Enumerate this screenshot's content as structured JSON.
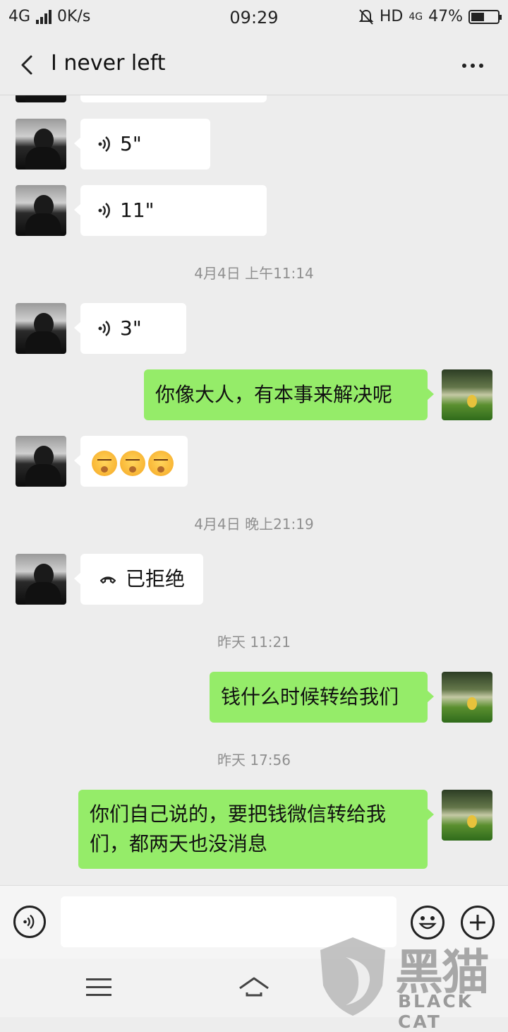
{
  "status_bar": {
    "network": "4G",
    "speed": "0K/s",
    "time": "09:29",
    "hd": "HD",
    "network2": "4G",
    "battery": "47%"
  },
  "header": {
    "title": "I never left"
  },
  "messages": {
    "m1_duration": "5\"",
    "m2_duration": "11\"",
    "ts1": "4月4日 上午11:14",
    "m3_duration": "3\"",
    "m4_text": "你像大人，有本事来解决呢",
    "ts2": "4月4日 晚上21:19",
    "m6_text": "已拒绝",
    "ts3": "昨天 11:21",
    "m7_text": "钱什么时候转给我们",
    "ts4": "昨天 17:56",
    "m8_text_line1": "你们自己说的，要把钱微信转给我",
    "m8_text_line2": "们，都两天也没消息"
  },
  "input_bar": {
    "value": "",
    "icons": [
      "voice-icon",
      "emoji-icon",
      "plus-icon"
    ]
  },
  "watermark": {
    "logo": "黑猫",
    "text": "BLACK CAT"
  },
  "colors": {
    "background": "#ededed",
    "my_bubble": "#95ec69",
    "their_bubble": "#ffffff",
    "timestamp": "#8f8f8f"
  }
}
